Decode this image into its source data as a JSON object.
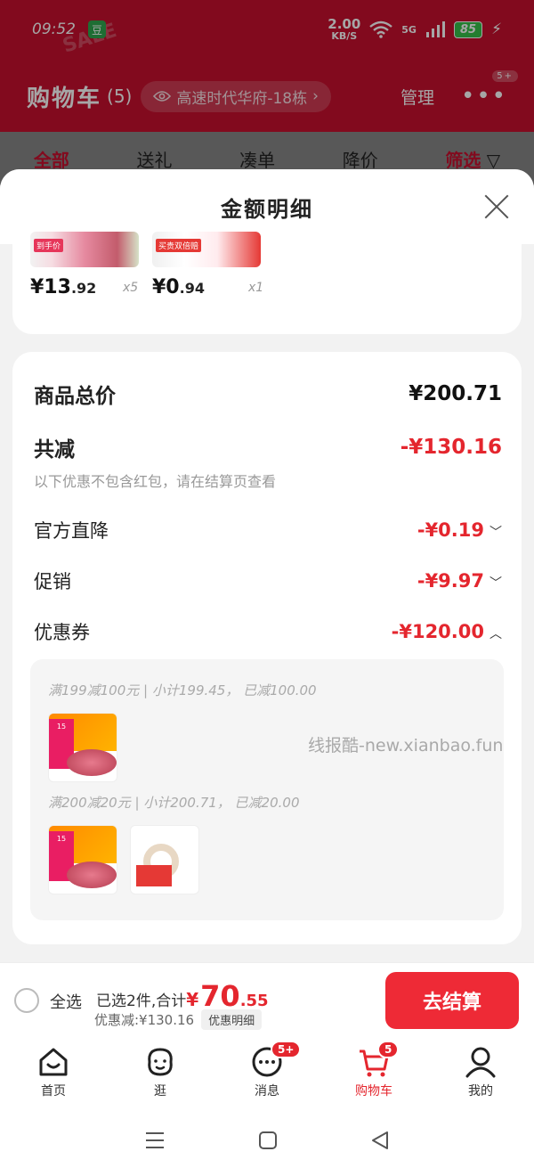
{
  "status_bar": {
    "time": "09:52",
    "app_badge": "豆",
    "net_speed_value": "2.00",
    "net_speed_unit": "KB/S",
    "network_type": "5G",
    "battery": "85"
  },
  "background": {
    "cart_title": "购物车",
    "cart_count": "(5)",
    "address": "高速时代华府-18栋",
    "manage_label": "管理",
    "more_badge": "5+",
    "tabs": [
      "全部",
      "送礼",
      "凑单",
      "降价",
      "筛选"
    ]
  },
  "sheet": {
    "title": "金额明细",
    "items": [
      {
        "price_int": "¥13",
        "price_dec": ".92",
        "qty": "x5",
        "label": "到手价"
      },
      {
        "price_int": "¥0",
        "price_dec": ".94",
        "qty": "x1",
        "label": "买贵双倍赔"
      }
    ],
    "total_label": "商品总价",
    "total_value": "¥200.71",
    "reduce_label": "共减",
    "reduce_value": "-¥130.16",
    "note": "以下优惠不包含红包，请在结算页查看",
    "rows": [
      {
        "label": "官方直降",
        "value": "-¥0.19",
        "chevron": "﹀"
      },
      {
        "label": "促销",
        "value": "-¥9.97",
        "chevron": "﹀"
      },
      {
        "label": "优惠券",
        "value": "-¥120.00",
        "chevron": "︿"
      }
    ],
    "coupons": [
      {
        "text": "满199减100元 | 小计199.45， 已减100.00"
      },
      {
        "text": "满200减20元 | 小计200.71， 已减20.00"
      }
    ]
  },
  "watermark": "线报酷-new.xianbao.fun",
  "checkout": {
    "select_all": "全选",
    "selected_text": "已选2件,合计",
    "total_symbol": "¥",
    "total_int": "70",
    "total_dec": ".55",
    "discount_text": "优惠减:¥130.16",
    "detail_button": "优惠明细",
    "checkout_button": "去结算"
  },
  "tabbar": {
    "items": [
      {
        "label": "首页",
        "icon": "home-icon"
      },
      {
        "label": "逛",
        "icon": "browse-icon"
      },
      {
        "label": "消息",
        "icon": "message-icon",
        "badge": "5+"
      },
      {
        "label": "购物车",
        "icon": "cart-icon",
        "badge": "5",
        "active": true
      },
      {
        "label": "我的",
        "icon": "profile-icon"
      }
    ]
  },
  "colors": {
    "brand_red": "#c8102e",
    "price_red": "#e4262e",
    "checkout_red": "#ee2a36"
  }
}
